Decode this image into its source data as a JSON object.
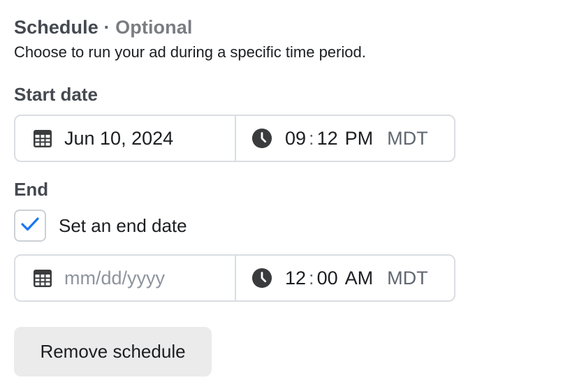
{
  "schedule": {
    "title": "Schedule",
    "separator": "·",
    "optional_label": "Optional",
    "description": "Choose to run your ad during a specific time period."
  },
  "start": {
    "label": "Start date",
    "date_value": "Jun 10, 2024",
    "hour": "09",
    "minute": "12",
    "ampm": "PM",
    "timezone": "MDT"
  },
  "end": {
    "label": "End",
    "checkbox_label": "Set an end date",
    "checkbox_checked": true,
    "date_placeholder": "mm/dd/yyyy",
    "hour": "12",
    "minute": "00",
    "ampm": "AM",
    "timezone": "MDT"
  },
  "actions": {
    "remove_label": "Remove schedule"
  },
  "colors": {
    "accent": "#1877f2",
    "icon": "#3a3b3c",
    "border": "#dadde1",
    "button_bg": "#ebebeb"
  },
  "icons": {
    "calendar": "calendar-icon",
    "clock": "clock-icon",
    "check": "checkmark-icon"
  }
}
